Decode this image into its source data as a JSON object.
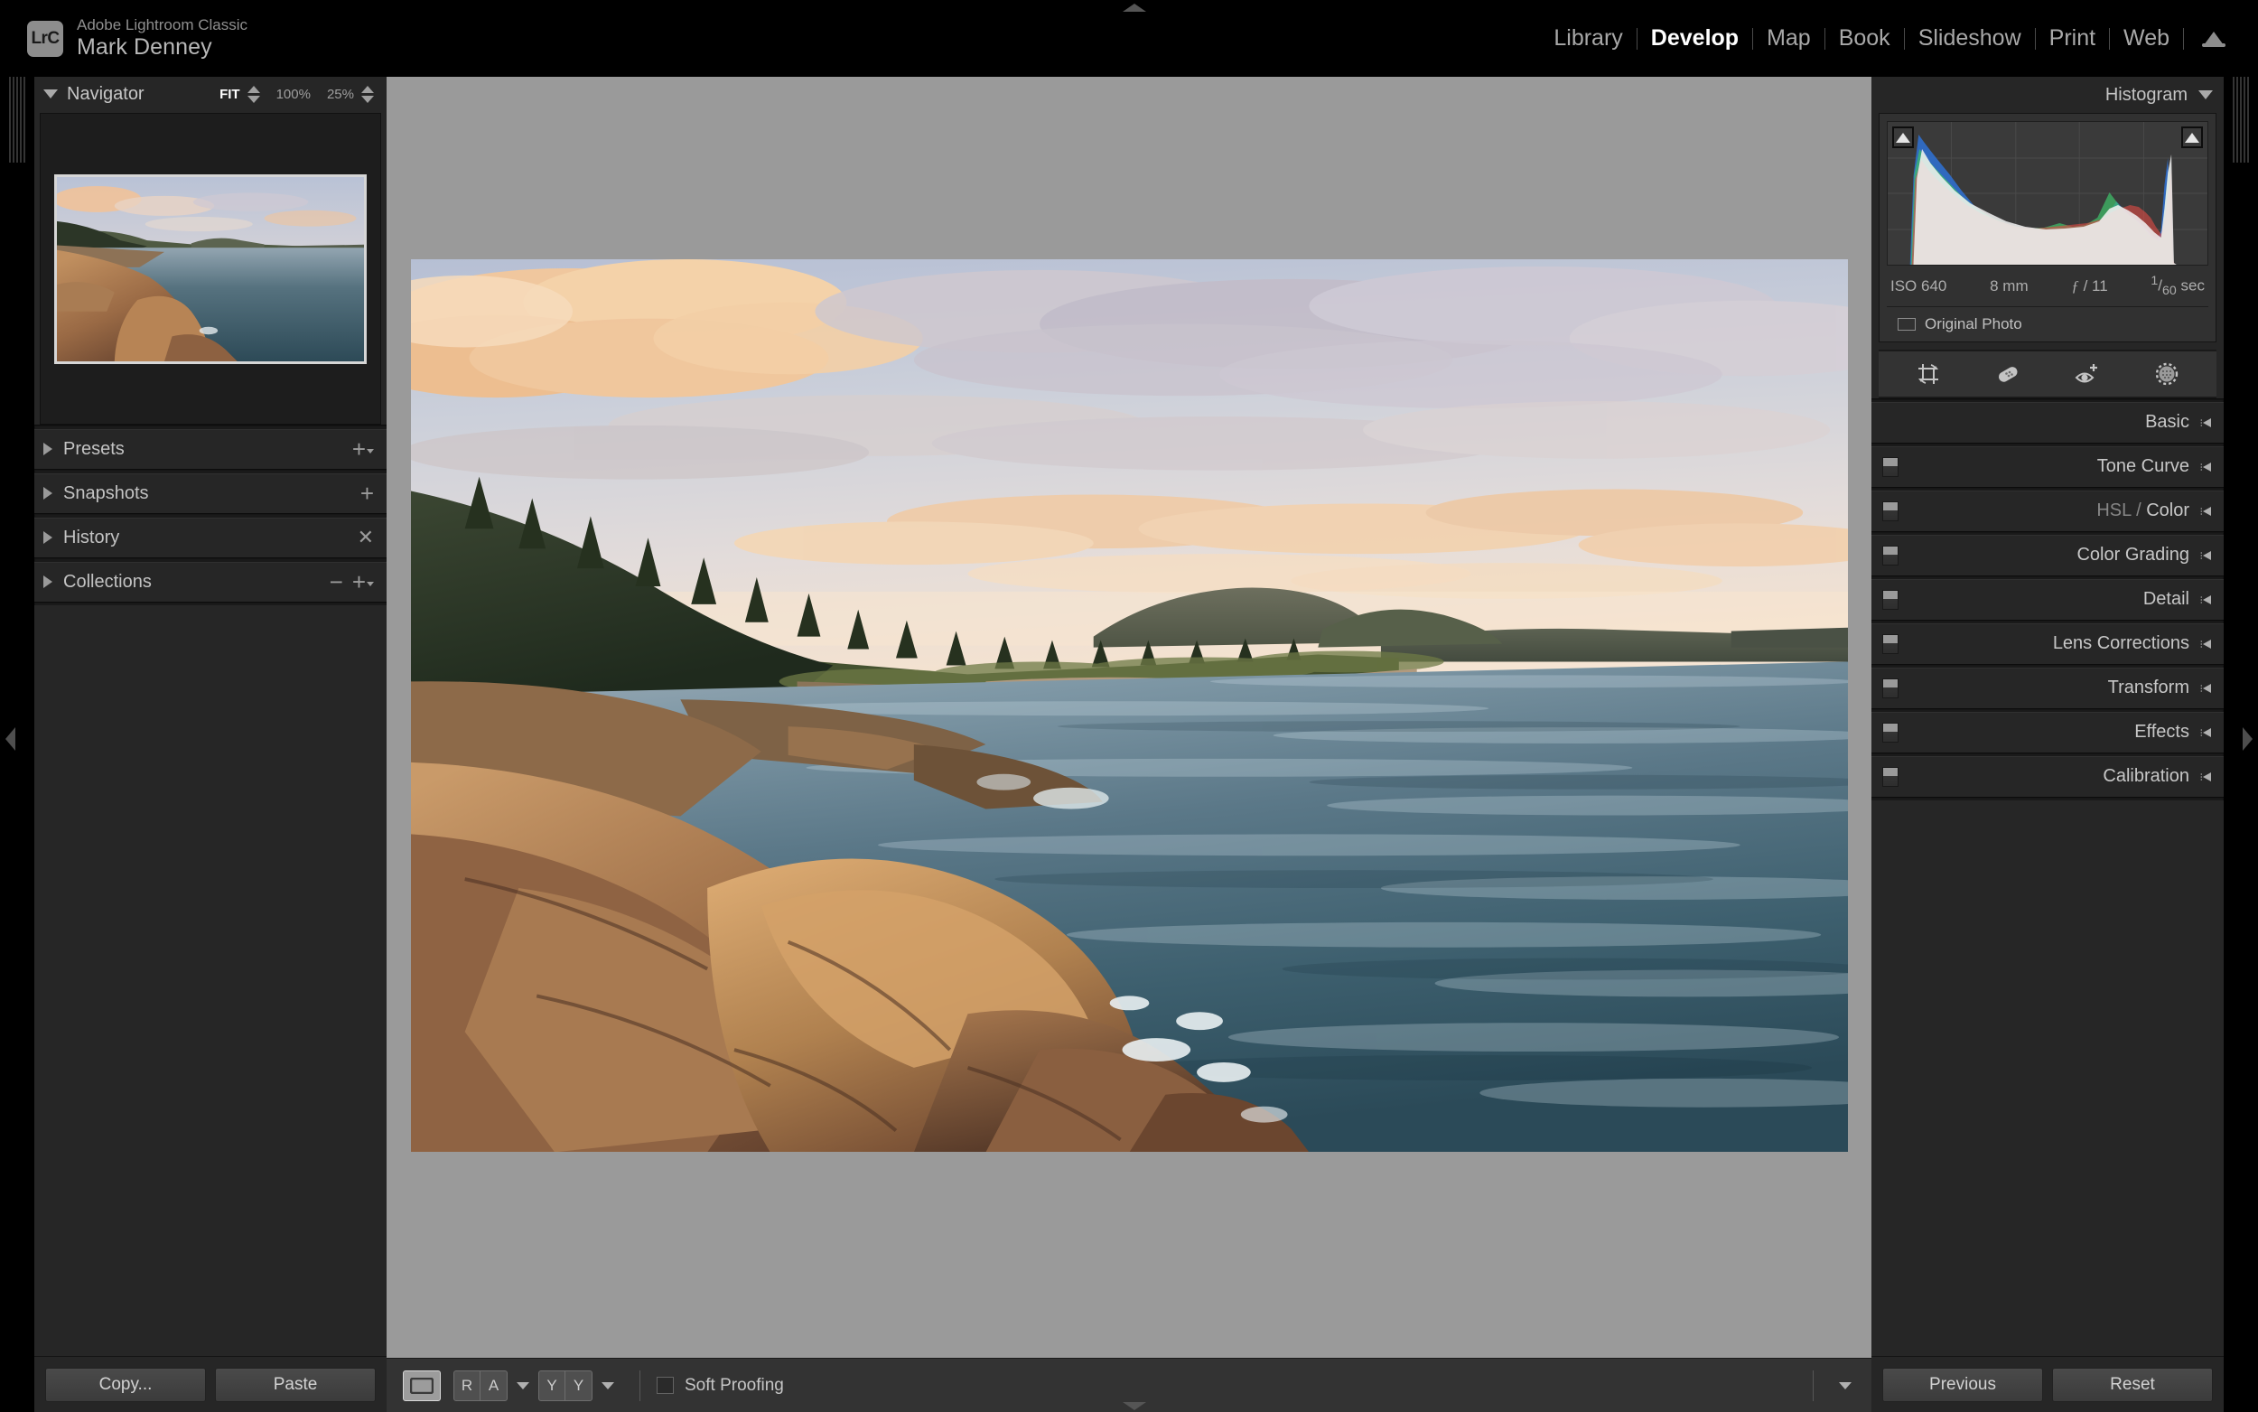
{
  "app": {
    "logo_text": "LrC",
    "product_name": "Adobe Lightroom Classic",
    "user_name": "Mark Denney"
  },
  "modules": {
    "items": [
      {
        "label": "Library",
        "active": false
      },
      {
        "label": "Develop",
        "active": true
      },
      {
        "label": "Map",
        "active": false
      },
      {
        "label": "Book",
        "active": false
      },
      {
        "label": "Slideshow",
        "active": false
      },
      {
        "label": "Print",
        "active": false
      },
      {
        "label": "Web",
        "active": false
      }
    ],
    "cloud_icon": "cloud-icon"
  },
  "left_panel": {
    "navigator": {
      "title": "Navigator",
      "zoom_levels": [
        {
          "label": "FIT",
          "active": true
        },
        {
          "label": "100%",
          "active": false
        },
        {
          "label": "25%",
          "active": false
        }
      ]
    },
    "sections": [
      {
        "label": "Presets",
        "actions": [
          "plus-chevron"
        ]
      },
      {
        "label": "Snapshots",
        "actions": [
          "plus"
        ]
      },
      {
        "label": "History",
        "actions": [
          "clear-x"
        ]
      },
      {
        "label": "Collections",
        "actions": [
          "minus",
          "plus-chevron"
        ]
      }
    ],
    "buttons": {
      "copy": "Copy...",
      "paste": "Paste"
    }
  },
  "right_panel": {
    "histogram": {
      "title": "Histogram",
      "exif": {
        "iso": "ISO 640",
        "focal_length": "8 mm",
        "aperture_symbol": "ƒ",
        "aperture": "/ 11",
        "shutter_num": "1",
        "shutter_den": "60",
        "shutter_unit": "sec"
      },
      "original_photo_label": "Original Photo",
      "clipping_left": "shadow-clipping-icon",
      "clipping_right": "highlight-clipping-icon"
    },
    "tools": [
      {
        "name": "crop-overlay-tool"
      },
      {
        "name": "spot-removal-tool"
      },
      {
        "name": "red-eye-correction-tool"
      },
      {
        "name": "masking-tool"
      }
    ],
    "sections": [
      {
        "label": "Basic",
        "dim_prefix": "",
        "has_switch": false
      },
      {
        "label": "Tone Curve",
        "dim_prefix": "",
        "has_switch": true
      },
      {
        "label": "Color",
        "dim_prefix": "HSL / ",
        "has_switch": true
      },
      {
        "label": "Color Grading",
        "dim_prefix": "",
        "has_switch": true
      },
      {
        "label": "Detail",
        "dim_prefix": "",
        "has_switch": true
      },
      {
        "label": "Lens Corrections",
        "dim_prefix": "",
        "has_switch": true
      },
      {
        "label": "Transform",
        "dim_prefix": "",
        "has_switch": true
      },
      {
        "label": "Effects",
        "dim_prefix": "",
        "has_switch": true
      },
      {
        "label": "Calibration",
        "dim_prefix": "",
        "has_switch": true
      }
    ],
    "buttons": {
      "previous": "Previous",
      "reset": "Reset"
    }
  },
  "toolbar": {
    "loupe_view": "loupe-view-icon",
    "before_after_left": "R",
    "before_after_right": "A",
    "compare_left": "Y",
    "compare_right": "Y",
    "soft_proofing_label": "Soft Proofing",
    "soft_proofing_checked": false,
    "toolbar_toggle": "chevron-down-icon"
  },
  "photo": {
    "description": "Coastal sunset landscape with granite rocks, forested headland and ocean",
    "colors": {
      "sky_high": "#c9cede",
      "sky_low": "#f4e3d3",
      "cloud_warm": "#f6c79a",
      "cloud_gold": "#f2b97e",
      "cloud_cool": "#b9b5c4",
      "forest_dark": "#2b3527",
      "forest_mid": "#4a5438",
      "headland": "#5d6350",
      "water_far": "#8fa2ae",
      "water_mid": "#53707f",
      "water_near": "#32505d",
      "rock_light": "#c09061",
      "rock_mid": "#9a6a44",
      "rock_dark": "#5e3d2c",
      "surf": "#e8eef0"
    }
  }
}
